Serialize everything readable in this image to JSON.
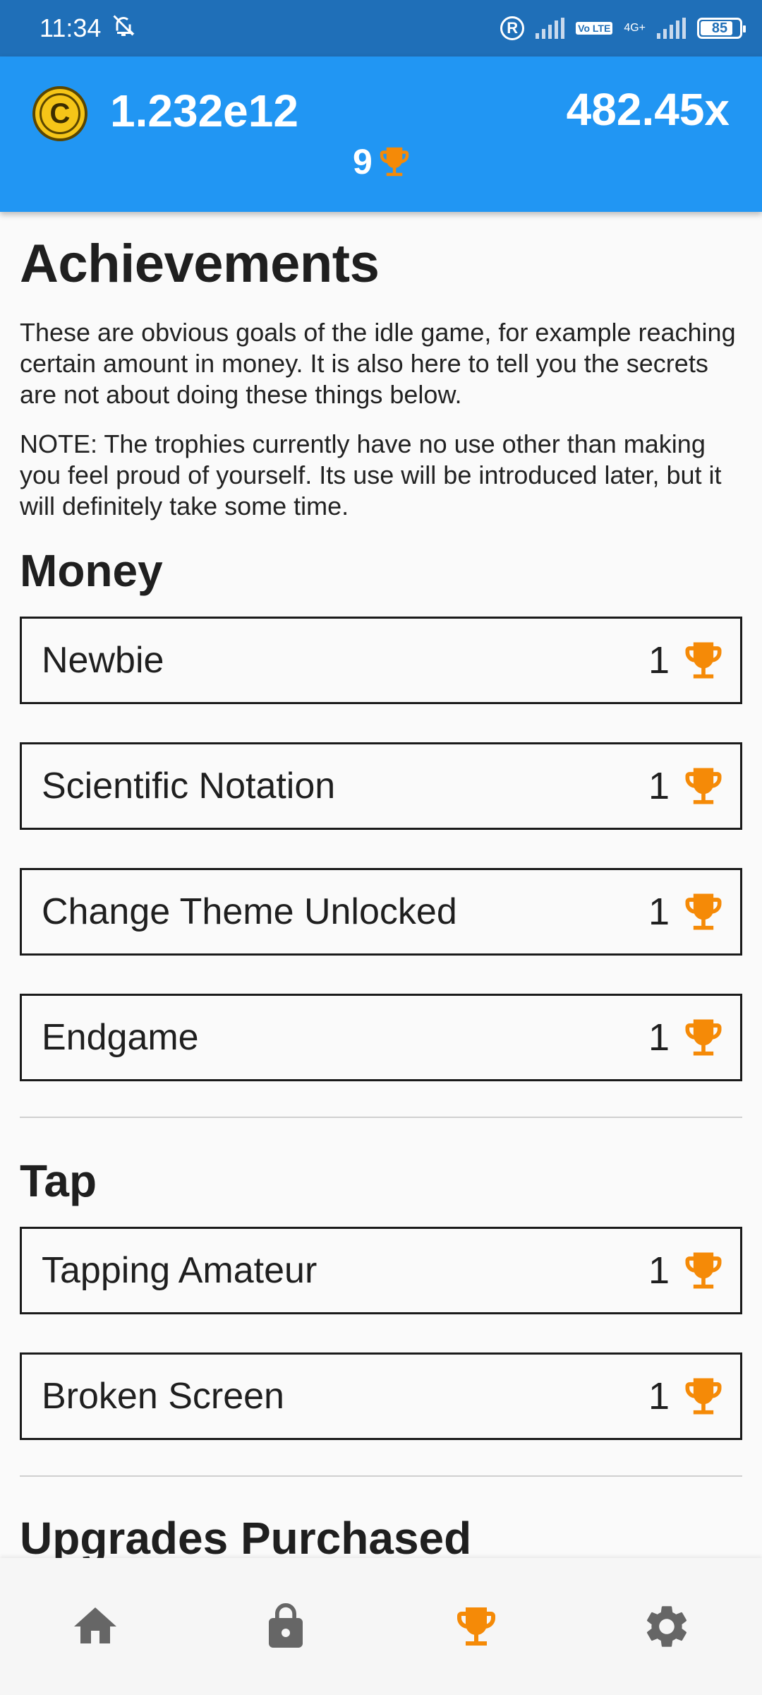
{
  "status_bar": {
    "time": "11:34",
    "battery": "85",
    "battery_level_percent": 85,
    "network_label": "4G+",
    "volte_label": "Vo LTE",
    "registered_label": "R"
  },
  "header": {
    "money": "1.232e12",
    "multiplier": "482.45x",
    "trophies": "9",
    "coin_letter": "C"
  },
  "page": {
    "title": "Achievements",
    "description": "These are obvious goals of the idle game, for example reaching certain amount in money. It is also here to tell you the secrets are not about doing these things below.",
    "note": "NOTE: The trophies currently have no use other than making you feel proud of yourself. Its use will be introduced later, but it will definitely take some time."
  },
  "sections": [
    {
      "title": "Money",
      "items": [
        {
          "name": "Newbie",
          "reward": "1"
        },
        {
          "name": "Scientific Notation",
          "reward": "1"
        },
        {
          "name": "Change Theme Unlocked",
          "reward": "1"
        },
        {
          "name": "Endgame",
          "reward": "1"
        }
      ]
    },
    {
      "title": "Tap",
      "items": [
        {
          "name": "Tapping Amateur",
          "reward": "1"
        },
        {
          "name": "Broken Screen",
          "reward": "1"
        }
      ]
    },
    {
      "title": "Upgrades Purchased",
      "items": []
    }
  ],
  "colors": {
    "header_bg": "#2196f3",
    "status_bg": "#1f6fb8",
    "trophy": "#f58a07",
    "nav_icon_inactive": "#666666",
    "nav_icon_active": "#f58a07"
  },
  "nav": [
    {
      "icon": "home-icon",
      "active": false
    },
    {
      "icon": "lock-icon",
      "active": false
    },
    {
      "icon": "trophy-icon",
      "active": true
    },
    {
      "icon": "gear-icon",
      "active": false
    }
  ]
}
